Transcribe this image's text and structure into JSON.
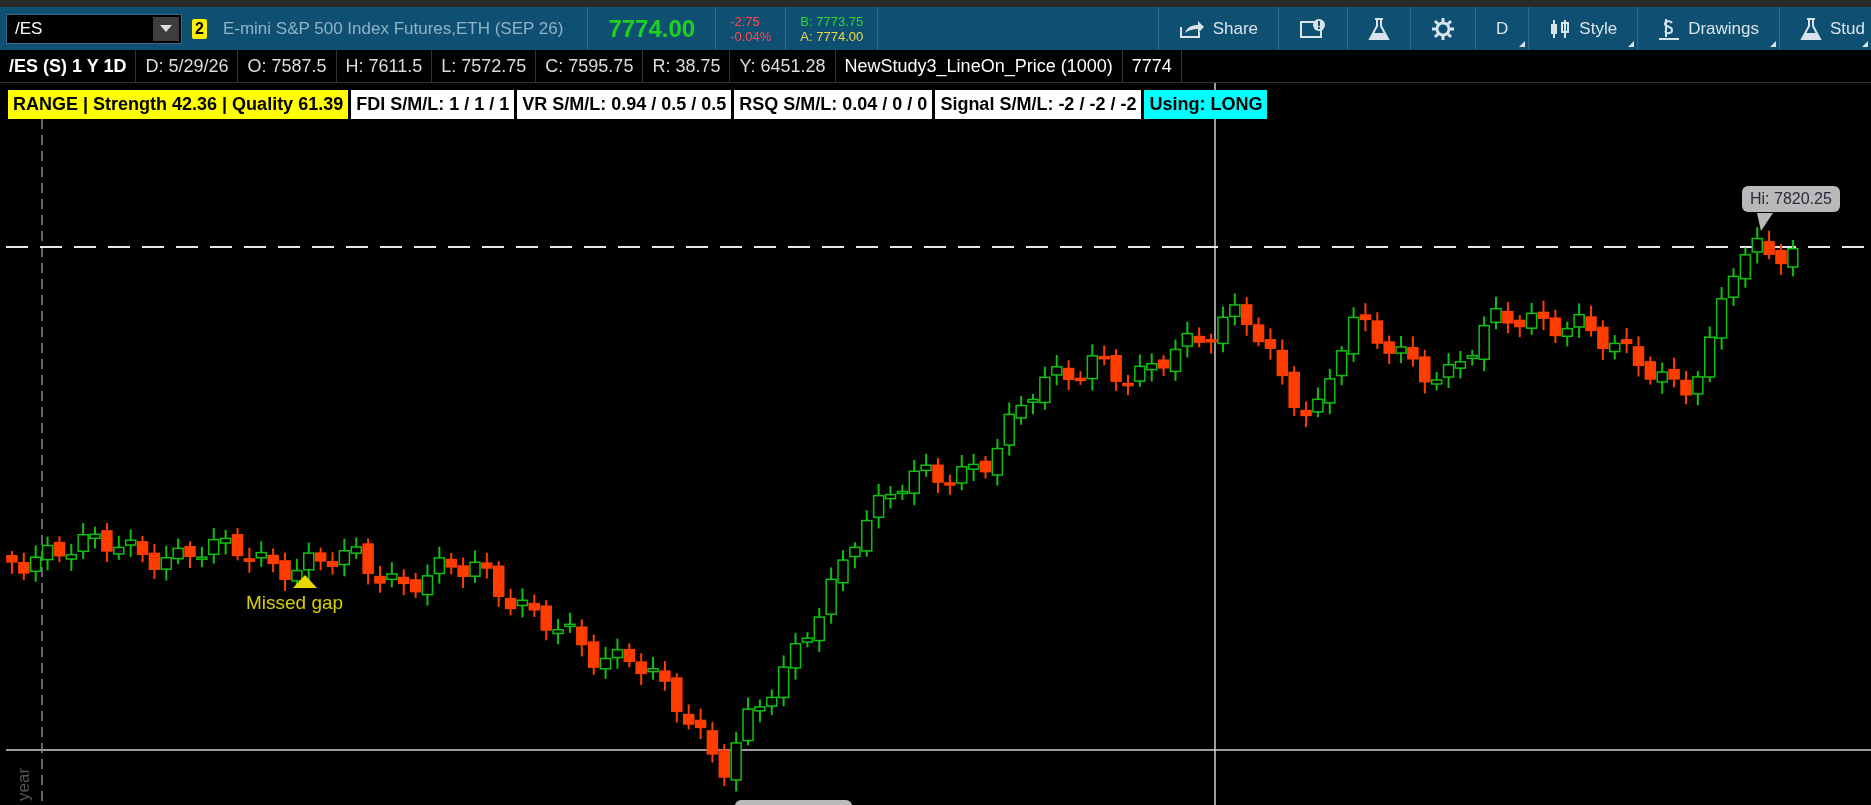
{
  "toolbar": {
    "symbol": "/ES",
    "link_badge": "2",
    "description": "E-mini S&P 500 Index Futures,ETH (SEP 26)",
    "last_price": "7774.00",
    "change": "-2.75",
    "change_percent": "-0.04%",
    "bid": "B: 7773.75",
    "ask": "A: 7774.00",
    "buttons": [
      {
        "kind": "share",
        "label": "Share"
      },
      {
        "kind": "alert"
      },
      {
        "kind": "flask"
      },
      {
        "kind": "gear"
      },
      {
        "kind": "text",
        "label": "D"
      },
      {
        "kind": "style",
        "label": "Style"
      },
      {
        "kind": "drawings",
        "label": "Drawings"
      },
      {
        "kind": "studies",
        "label": "Stud"
      }
    ]
  },
  "info_bar": [
    {
      "kind": "symbol",
      "text": "/ES (S) 1 Y 1D"
    },
    {
      "kind": "value",
      "text": "D: 5/29/26"
    },
    {
      "kind": "value",
      "text": "O: 7587.5"
    },
    {
      "kind": "value",
      "text": "H: 7611.5"
    },
    {
      "kind": "value",
      "text": "L: 7572.75"
    },
    {
      "kind": "value",
      "text": "C: 7595.75"
    },
    {
      "kind": "value",
      "text": "R: 38.75"
    },
    {
      "kind": "value",
      "text": "Y: 6451.28"
    },
    {
      "kind": "study",
      "text": "NewStudy3_LineOn_Price (1000)"
    },
    {
      "kind": "study",
      "text": "7774"
    }
  ],
  "study_labels": [
    {
      "text": "RANGE | Strength 42.36 | Quality 61.39",
      "color": "#ffff00"
    },
    {
      "text": "FDI S/M/L: 1 / 1 / 1",
      "color": "#ffffff"
    },
    {
      "text": "VR  S/M/L: 0.94 / 0.5 / 0.5",
      "color": "#ffffff"
    },
    {
      "text": "RSQ S/M/L: 0.04 / 0 / 0",
      "color": "#ffffff"
    },
    {
      "text": "Signal S/M/L: -2 / -2 / -2",
      "color": "#ffffff"
    },
    {
      "text": "Using: LONG",
      "color": "#00ffff"
    }
  ],
  "chart": {
    "high_bubble": "Hi: 7820.25",
    "annotation": "Missed gap",
    "axis_label": "year"
  }
}
